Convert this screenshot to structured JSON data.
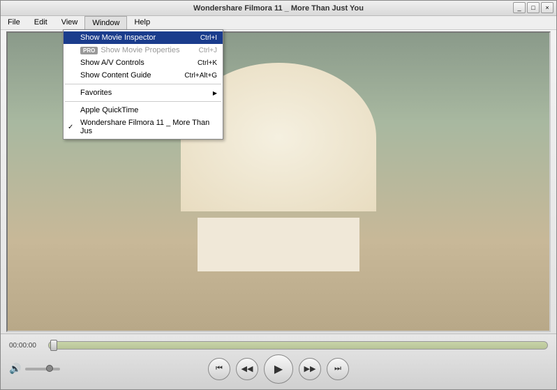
{
  "titlebar": {
    "text": "Wondershare Filmora 11 _ More Than Just You"
  },
  "menubar": {
    "items": [
      {
        "label": "File"
      },
      {
        "label": "Edit"
      },
      {
        "label": "View"
      },
      {
        "label": "Window"
      },
      {
        "label": "Help"
      }
    ]
  },
  "dropdown": {
    "items": [
      {
        "label": "Show Movie Inspector",
        "shortcut": "Ctrl+I"
      },
      {
        "pro": true,
        "label": "Show Movie Properties",
        "shortcut": "Ctrl+J"
      },
      {
        "label": "Show A/V Controls",
        "shortcut": "Ctrl+K"
      },
      {
        "label": "Show Content Guide",
        "shortcut": "Ctrl+Alt+G"
      }
    ],
    "favorites": "Favorites",
    "apple": "Apple QuickTime",
    "current": "Wondershare Filmora 11 _ More Than Jus"
  },
  "playback": {
    "time": "00:00:00"
  }
}
